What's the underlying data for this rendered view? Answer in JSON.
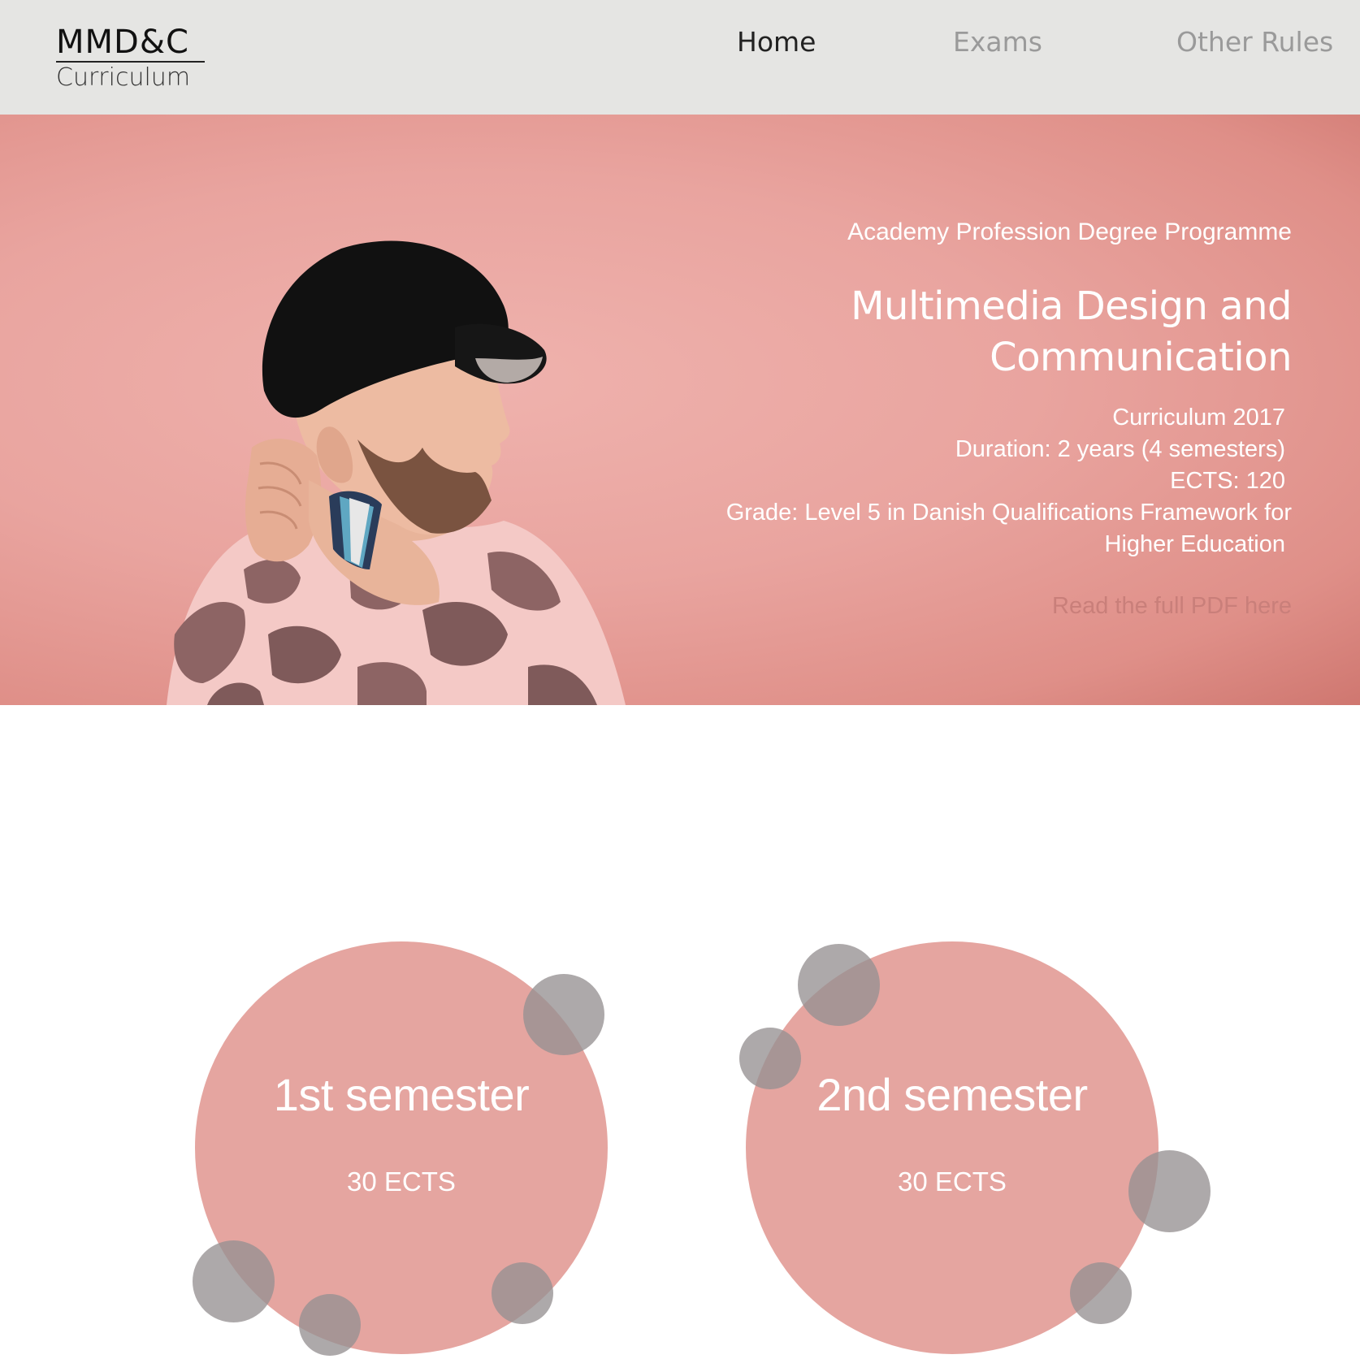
{
  "header": {
    "logo_main": "MMD&C",
    "logo_sub": "Curriculum",
    "nav": {
      "home": "Home",
      "exams": "Exams",
      "other_rules": "Other Rules"
    }
  },
  "hero": {
    "kicker": "Academy Profession Degree Programme",
    "title_line1": "Multimedia Design and",
    "title_line2": "Communication",
    "details": {
      "curriculum": "Curriculum 2017",
      "duration": "Duration: 2 years (4 semesters)",
      "ects": "ECTS: 120",
      "grade_line1": "Grade: Level 5 in Danish Qualifications Framework for",
      "grade_line2": "Higher Education"
    },
    "pdf_link": "Read the full PDF here"
  },
  "semesters": [
    {
      "title": "1st semester",
      "ects": "30 ECTS"
    },
    {
      "title": "2nd semester",
      "ects": "30 ECTS"
    }
  ],
  "colors": {
    "header_bg": "#e5e5e3",
    "hero_bg": "#e9a49f",
    "circle": "#e5a5a0",
    "bubble": "#969192",
    "nav_active": "#222222",
    "nav_inactive": "#9a9a9a"
  }
}
